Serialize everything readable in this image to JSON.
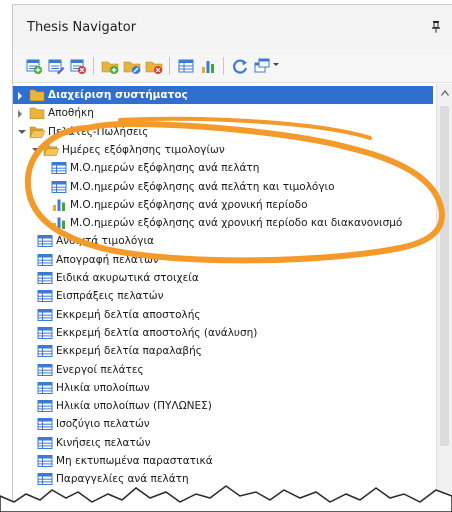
{
  "window": {
    "title": "Thesis Navigator",
    "pin_icon": "pin-icon"
  },
  "toolbar": {
    "buttons": [
      {
        "name": "add-document-icon"
      },
      {
        "name": "edit-document-icon"
      },
      {
        "name": "delete-document-icon"
      },
      {
        "name": "add-folder-icon"
      },
      {
        "name": "edit-folder-icon"
      },
      {
        "name": "delete-folder-icon"
      },
      {
        "name": "table-view-icon"
      },
      {
        "name": "bar-chart-icon"
      },
      {
        "name": "refresh-icon"
      },
      {
        "name": "window-layout-icon"
      }
    ]
  },
  "tree": {
    "items": [
      {
        "label": "Διαχείριση συστήματος",
        "icon": "folder-icon",
        "expander": "collapsed",
        "selected": true
      },
      {
        "label": "Αποθήκη",
        "icon": "folder-icon",
        "expander": "collapsed"
      },
      {
        "label": "Πελάτες-Πωλήσεις",
        "icon": "folder-open-icon",
        "expander": "expanded"
      },
      {
        "label": "Ημέρες εξόφλησης τιμολογίων",
        "icon": "folder-open-icon",
        "expander": "expanded"
      },
      {
        "label": "Μ.Ο.ημερών εξόφλησης ανά πελάτη",
        "icon": "table-icon"
      },
      {
        "label": "Μ.Ο.ημερών εξόφλησης ανά πελάτη και τιμολόγιο",
        "icon": "table-icon"
      },
      {
        "label": "Μ.Ο.ημερών εξόφλησης ανά χρονική περίοδο",
        "icon": "bar-chart-icon"
      },
      {
        "label": "Μ.Ο.ημερών εξόφλησης ανά χρονική περίοδο και διακανονισμό",
        "icon": "bar-chart-icon"
      },
      {
        "label": "Ανοιχτά τιμολόγια",
        "icon": "table-icon"
      },
      {
        "label": "Απογραφή πελατών",
        "icon": "table-icon"
      },
      {
        "label": "Ειδικά ακυρωτικά στοιχεία",
        "icon": "table-icon"
      },
      {
        "label": "Εισπράξεις πελατών",
        "icon": "table-icon"
      },
      {
        "label": "Εκκρεμή δελτία αποστολής",
        "icon": "table-icon"
      },
      {
        "label": "Εκκρεμή δελτία αποστολής (ανάλυση)",
        "icon": "table-icon"
      },
      {
        "label": "Εκκρεμή δελτία παραλαβής",
        "icon": "table-icon"
      },
      {
        "label": "Ενεργοί πελάτες",
        "icon": "table-icon"
      },
      {
        "label": "Ηλικία υπολοίπων",
        "icon": "table-icon"
      },
      {
        "label": "Ηλικία υπολοίπων (ΠΥΛΩΝΕΣ)",
        "icon": "table-icon"
      },
      {
        "label": "Ισοζύγιο πελατών",
        "icon": "table-icon"
      },
      {
        "label": "Κινήσεις πελατών",
        "icon": "table-icon"
      },
      {
        "label": "Μη εκτυπωμένα παραστατικά",
        "icon": "table-icon"
      },
      {
        "label": "Παραγγελίες ανά πελάτη",
        "icon": "table-icon"
      }
    ]
  },
  "colors": {
    "selection": "#2e6fd0",
    "highlight_ring": "#f39a2b",
    "table_icon": "#3a7bd5",
    "folder_icon": "#e8b53a"
  }
}
